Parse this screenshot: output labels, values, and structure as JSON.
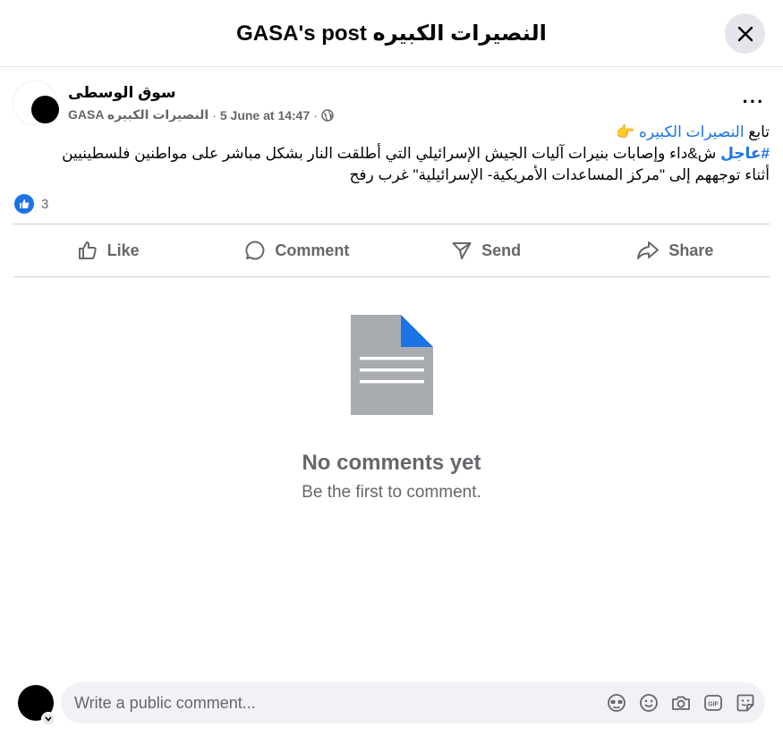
{
  "header": {
    "title": "GASA's post النصيرات الكبيره"
  },
  "post": {
    "author": "سوق الوسطى",
    "group": "GASA النصيرات الكبيره",
    "separator": "·",
    "date": "5 June at 14:47",
    "more_label": "···",
    "line1_prefix": "تابع ",
    "line1_link": "النصيرات الكبيره",
    "line1_emoji": " 👉",
    "line2_hashtag": "#عاجل",
    "line2_text": " ش&داء وإصابات بنيرات آليات الجيش الإسرائيلي التي أطلقت النار بشكل مباشر على مواطنين فلسطينيين",
    "line3_text": "أثناء توجههم إلى \"مركز المساعدات الأمريكية- الإسرائيلية\" غرب رفح",
    "reaction_count": "3"
  },
  "actions": {
    "like": "Like",
    "comment": "Comment",
    "send": "Send",
    "share": "Share"
  },
  "empty": {
    "title": "No comments yet",
    "subtitle": "Be the first to comment."
  },
  "composer": {
    "placeholder": "Write a public comment..."
  },
  "colors": {
    "accent": "#1b74e4",
    "secondary_text": "#65676b",
    "doc_gray": "#a8abb0"
  }
}
